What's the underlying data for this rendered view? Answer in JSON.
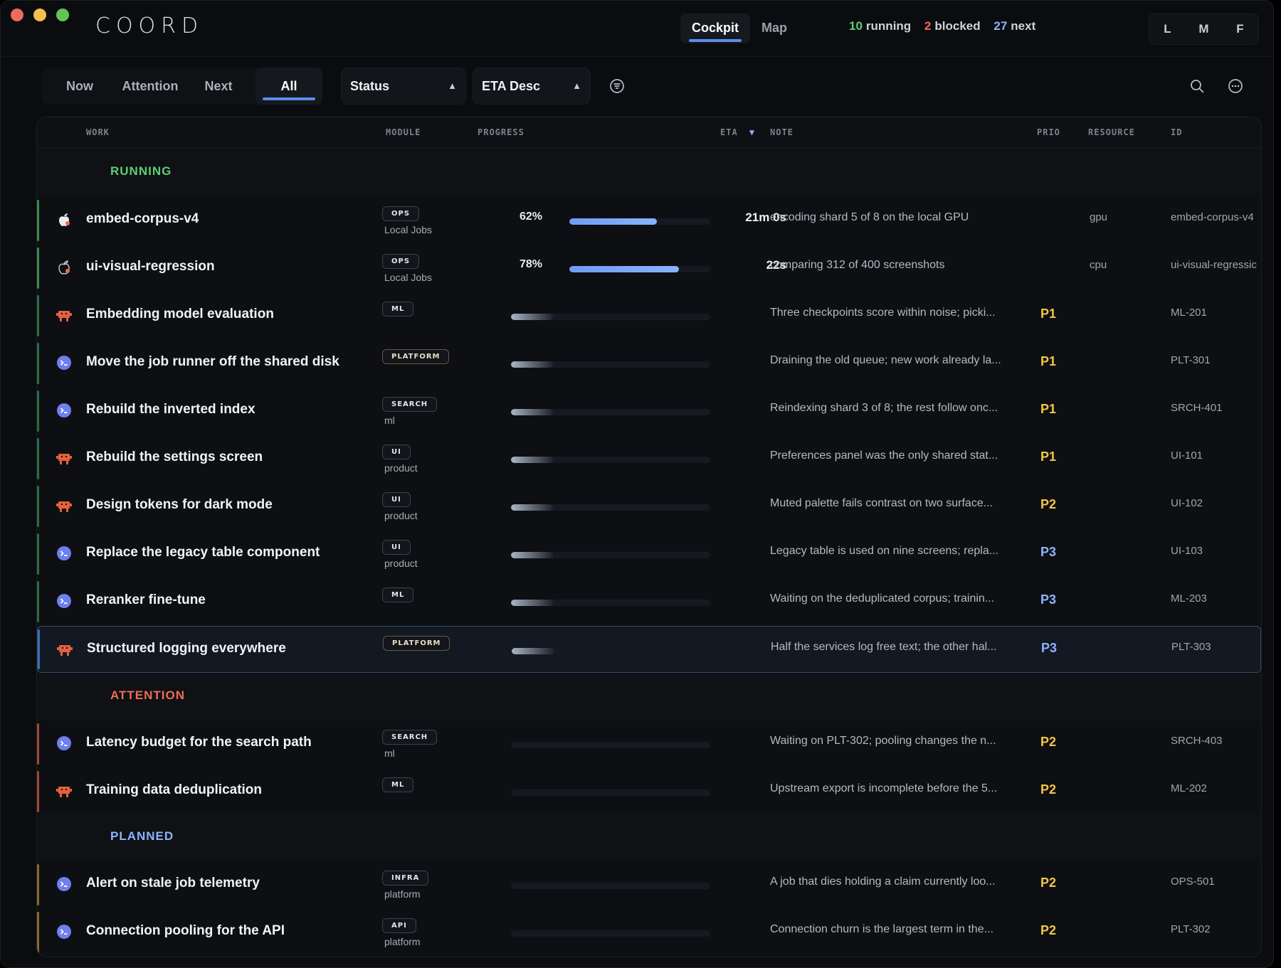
{
  "app": {
    "logo": "COORD"
  },
  "topnav": {
    "tabs": [
      "Cockpit",
      "Map"
    ],
    "active": "Cockpit"
  },
  "counts": {
    "running_n": "10",
    "running_label": "running",
    "blocked_n": "2",
    "blocked_label": "blocked",
    "next_n": "27",
    "next_label": "next"
  },
  "density": [
    "L",
    "M",
    "F"
  ],
  "filters": {
    "tabs": [
      "Now",
      "Attention",
      "Next",
      "All"
    ],
    "active": "All"
  },
  "status_select": {
    "value": "Status"
  },
  "sort_select": {
    "value": "ETA Desc"
  },
  "columns": {
    "work": "WORK",
    "module": "MODULE",
    "progress": "PROGRESS",
    "eta": "ETA",
    "note": "NOTE",
    "prio": "PRIO",
    "resource": "RESOURCE",
    "id": "ID"
  },
  "colors": {
    "running": "#5fcf74",
    "attention": "#ef6b58",
    "planned": "#8fb3ff",
    "p1": "#f4c545",
    "p2": "#f4c545",
    "p3": "#8fb3ff",
    "accent": "#5b8dee"
  },
  "groups": {
    "running": {
      "label": "RUNNING"
    },
    "attention": {
      "label": "ATTENTION"
    },
    "planned": {
      "label": "PLANNED"
    }
  },
  "rows": [
    {
      "title": "embed-corpus-v4",
      "module": "OPS",
      "module_sub": "Local Jobs",
      "progress_pct": "62%",
      "progress": 0.62,
      "eta": "21m 0s",
      "note": "encoding shard 5 of 8 on the local GPU",
      "prio": "",
      "resource": "gpu",
      "id": "embed-corpus-v4",
      "icon": "apple-icon"
    },
    {
      "title": "ui-visual-regression",
      "module": "OPS",
      "module_sub": "Local Jobs",
      "progress_pct": "78%",
      "progress": 0.78,
      "eta": "22s",
      "note": "comparing 312 of 400 screenshots",
      "prio": "",
      "resource": "cpu",
      "id": "ui-visual-regressic",
      "icon": "apple-outline-icon"
    },
    {
      "title": "Embedding model evaluation",
      "module": "ML",
      "module_sub": "",
      "note": "Three checkpoints score within noise; picki...",
      "prio": "P1",
      "resource": "",
      "id": "ML-201",
      "icon": "robot-icon"
    },
    {
      "title": "Move the job runner off the shared disk",
      "module": "PLATFORM",
      "module_sub": "",
      "note": "Draining the old queue; new work already la...",
      "prio": "P1",
      "resource": "",
      "id": "PLT-301",
      "icon": "terminal-icon"
    },
    {
      "title": "Rebuild the inverted index",
      "module": "SEARCH",
      "module_sub": "ml",
      "note": "Reindexing shard 3 of 8; the rest follow onc...",
      "prio": "P1",
      "resource": "",
      "id": "SRCH-401",
      "icon": "terminal-icon"
    },
    {
      "title": "Rebuild the settings screen",
      "module": "UI",
      "module_sub": "product",
      "note": "Preferences panel was the only shared stat...",
      "prio": "P1",
      "resource": "",
      "id": "UI-101",
      "icon": "robot-icon"
    },
    {
      "title": "Design tokens for dark mode",
      "module": "UI",
      "module_sub": "product",
      "note": "Muted palette fails contrast on two surface...",
      "prio": "P2",
      "resource": "",
      "id": "UI-102",
      "icon": "robot-icon"
    },
    {
      "title": "Replace the legacy table component",
      "module": "UI",
      "module_sub": "product",
      "note": "Legacy table is used on nine screens; repla...",
      "prio": "P3",
      "resource": "",
      "id": "UI-103",
      "icon": "terminal-icon"
    },
    {
      "title": "Reranker fine-tune",
      "module": "ML",
      "module_sub": "",
      "note": "Waiting on the deduplicated corpus; trainin...",
      "prio": "P3",
      "resource": "",
      "id": "ML-203",
      "icon": "terminal-icon"
    },
    {
      "title": "Structured logging everywhere",
      "module": "PLATFORM",
      "module_sub": "",
      "note": "Half the services log free text; the other hal...",
      "prio": "P3",
      "resource": "",
      "id": "PLT-303",
      "icon": "robot-icon"
    },
    {
      "title": "Latency budget for the search path",
      "module": "SEARCH",
      "module_sub": "ml",
      "note": "Waiting on PLT-302; pooling changes the n...",
      "prio": "P2",
      "resource": "",
      "id": "SRCH-403",
      "icon": "terminal-icon"
    },
    {
      "title": "Training data deduplication",
      "module": "ML",
      "module_sub": "",
      "note": "Upstream export is incomplete before the 5...",
      "prio": "P2",
      "resource": "",
      "id": "ML-202",
      "icon": "robot-icon"
    },
    {
      "title": "Alert on stale job telemetry",
      "module": "INFRA",
      "module_sub": "platform",
      "note": "A job that dies holding a claim currently loo...",
      "prio": "P2",
      "resource": "",
      "id": "OPS-501",
      "icon": "terminal-icon"
    },
    {
      "title": "Connection pooling for the API",
      "module": "API",
      "module_sub": "platform",
      "note": "Connection churn is the largest term in the...",
      "prio": "P2",
      "resource": "",
      "id": "PLT-302",
      "icon": "terminal-icon"
    }
  ]
}
